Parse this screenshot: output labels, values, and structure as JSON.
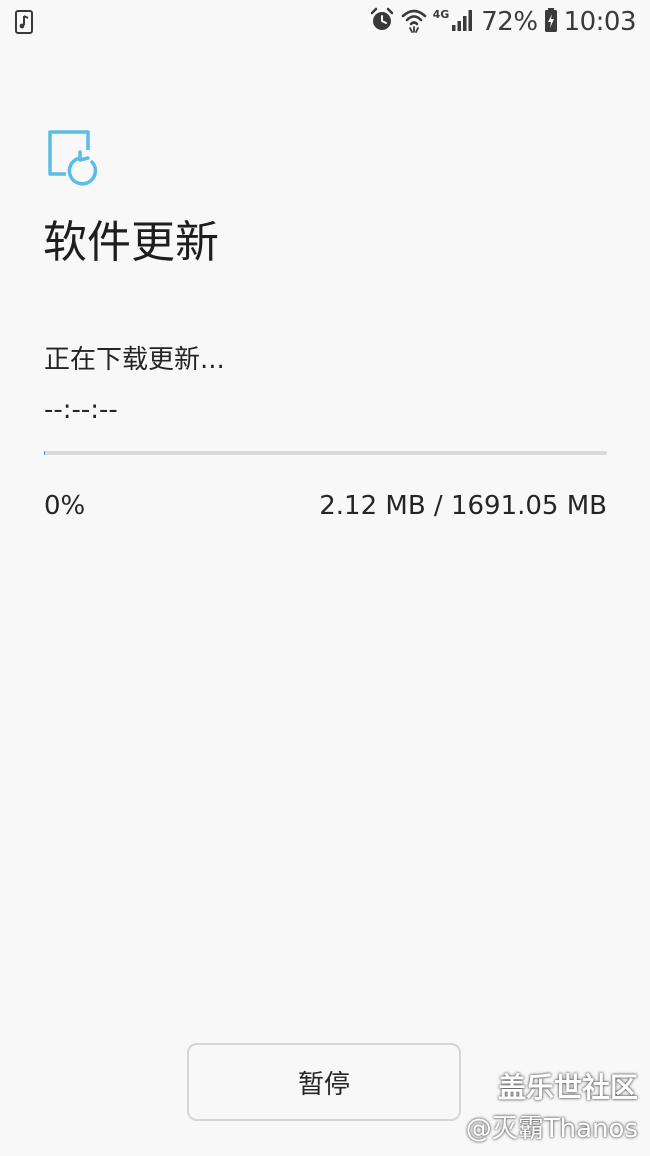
{
  "status_bar": {
    "left_icon": "phone-music-icon",
    "icons": [
      "alarm-icon",
      "wifi-icon",
      "signal-icon",
      "battery-charging-icon"
    ],
    "network_type": "4G",
    "battery_percent": "72%",
    "time": "10:03"
  },
  "header": {
    "icon": "software-update-icon",
    "title": "软件更新"
  },
  "download": {
    "status_text": "正在下载更新...",
    "remaining_time": "--:--:--",
    "progress_fraction": 0.0012,
    "percent_text": "0%",
    "size_text": "2.12 MB / 1691.05 MB"
  },
  "actions": {
    "pause_label": "暂停"
  },
  "watermark": {
    "line1": "盖乐世社区",
    "line2": "@灭霸Thanos"
  },
  "colors": {
    "background": "#f8f8f8",
    "accent": "#5bbde6",
    "text": "#252525",
    "progress_track": "#d9d9d9",
    "progress_fill": "#4a90c2"
  }
}
